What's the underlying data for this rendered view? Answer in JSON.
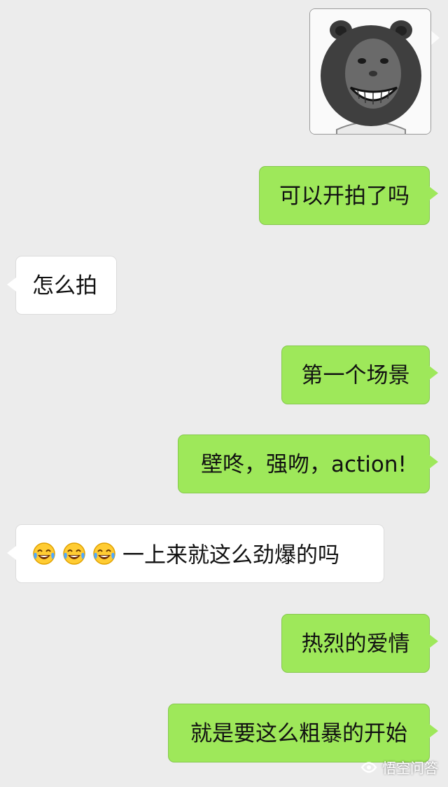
{
  "sticker": {
    "description_icon": "grinning-bear-sticker-icon"
  },
  "messages": [
    {
      "side": "out",
      "text": "可以开拍了吗"
    },
    {
      "side": "in",
      "text": "怎么拍"
    },
    {
      "side": "out",
      "text": "第一个场景"
    },
    {
      "side": "out",
      "text": "壁咚，强吻，action!"
    },
    {
      "side": "in",
      "emoji": [
        "face-with-tears-of-joy-icon",
        "face-with-tears-of-joy-icon",
        "face-with-tears-of-joy-icon"
      ],
      "text": "一上来就这么劲爆的吗"
    },
    {
      "side": "out",
      "text": "热烈的爱情"
    },
    {
      "side": "out",
      "text": "就是要这么粗暴的开始"
    }
  ],
  "watermark": {
    "text": "悟空问答",
    "icon": "wukong-logo-icon"
  },
  "colors": {
    "background": "#ececec",
    "outgoing_bubble": "#9ee85a",
    "incoming_bubble": "#ffffff"
  }
}
